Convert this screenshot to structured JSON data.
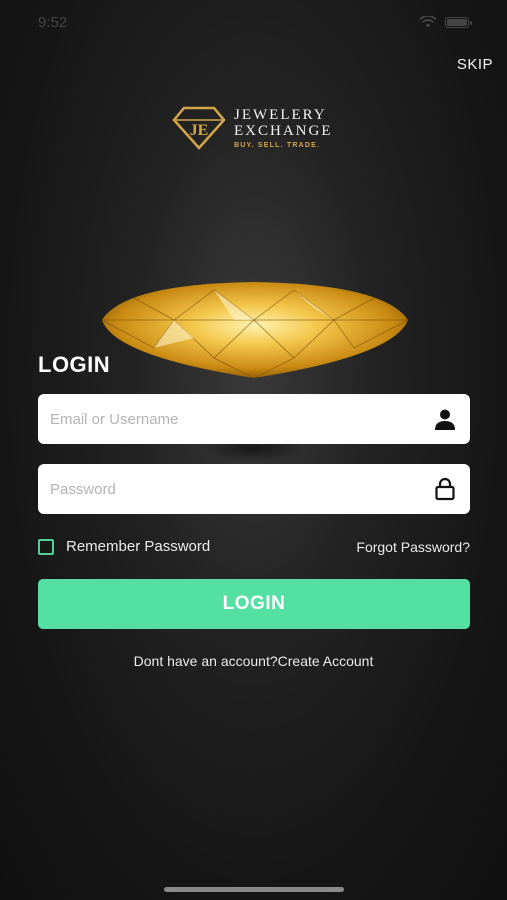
{
  "status_bar": {
    "time": "9:52"
  },
  "header": {
    "skip_label": "SKIP"
  },
  "logo": {
    "line1": "JEWELERY",
    "line2": "EXCHANGE",
    "tagline": "BUY. SELL. TRADE.",
    "monogram": "JE",
    "gold_color": "#d4a64a"
  },
  "form": {
    "title": "LOGIN",
    "email_placeholder": "Email or Username",
    "email_value": "",
    "email_icon": "user-icon",
    "password_placeholder": "Password",
    "password_value": "",
    "password_icon": "lock-icon",
    "remember_label": "Remember Password",
    "remember_checked": false,
    "forgot_label": "Forgot Password?",
    "submit_label": "LOGIN",
    "submit_color": "#55e0a3"
  },
  "footer": {
    "signup_text": "Dont have an account?Create Account"
  }
}
